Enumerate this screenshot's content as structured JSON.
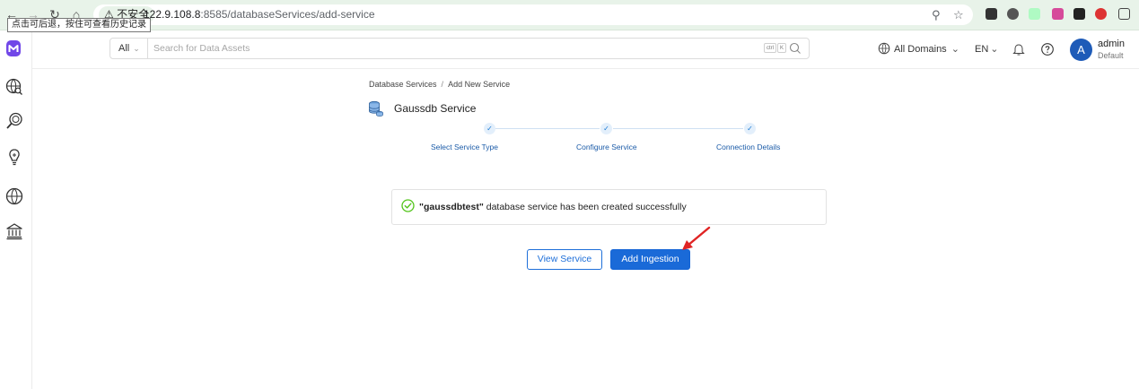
{
  "browser": {
    "insecure_label": "⚠ 不安全",
    "url_host": "122.9.108.8",
    "url_path": ":8585/databaseServices/add-service",
    "tooltip": "点击可后退，按住可查看历史记录"
  },
  "header": {
    "search_scope": "All",
    "search_placeholder": "Search for Data Assets",
    "kbd_ctrl": "ctrl",
    "kbd_k": "K",
    "domains_label": "All Domains",
    "language": "EN",
    "user_name": "admin",
    "user_role": "Default",
    "avatar_initial": "A"
  },
  "breadcrumb": {
    "root": "Database Services",
    "separator": "/",
    "current": "Add New Service"
  },
  "service": {
    "title": "Gaussdb Service"
  },
  "steps": [
    {
      "label": "Select Service Type",
      "done": true
    },
    {
      "label": "Configure Service",
      "done": true
    },
    {
      "label": "Connection Details",
      "done": true
    }
  ],
  "success": {
    "name": "\"gaussdbtest\"",
    "message": " database service has been created successfully"
  },
  "actions": {
    "view_service": "View Service",
    "add_ingestion": "Add Ingestion"
  },
  "colors": {
    "primary": "#1a6ad8",
    "success": "#52c41a",
    "arrow": "#e02424",
    "browser_bar": "#e8f3e9"
  }
}
